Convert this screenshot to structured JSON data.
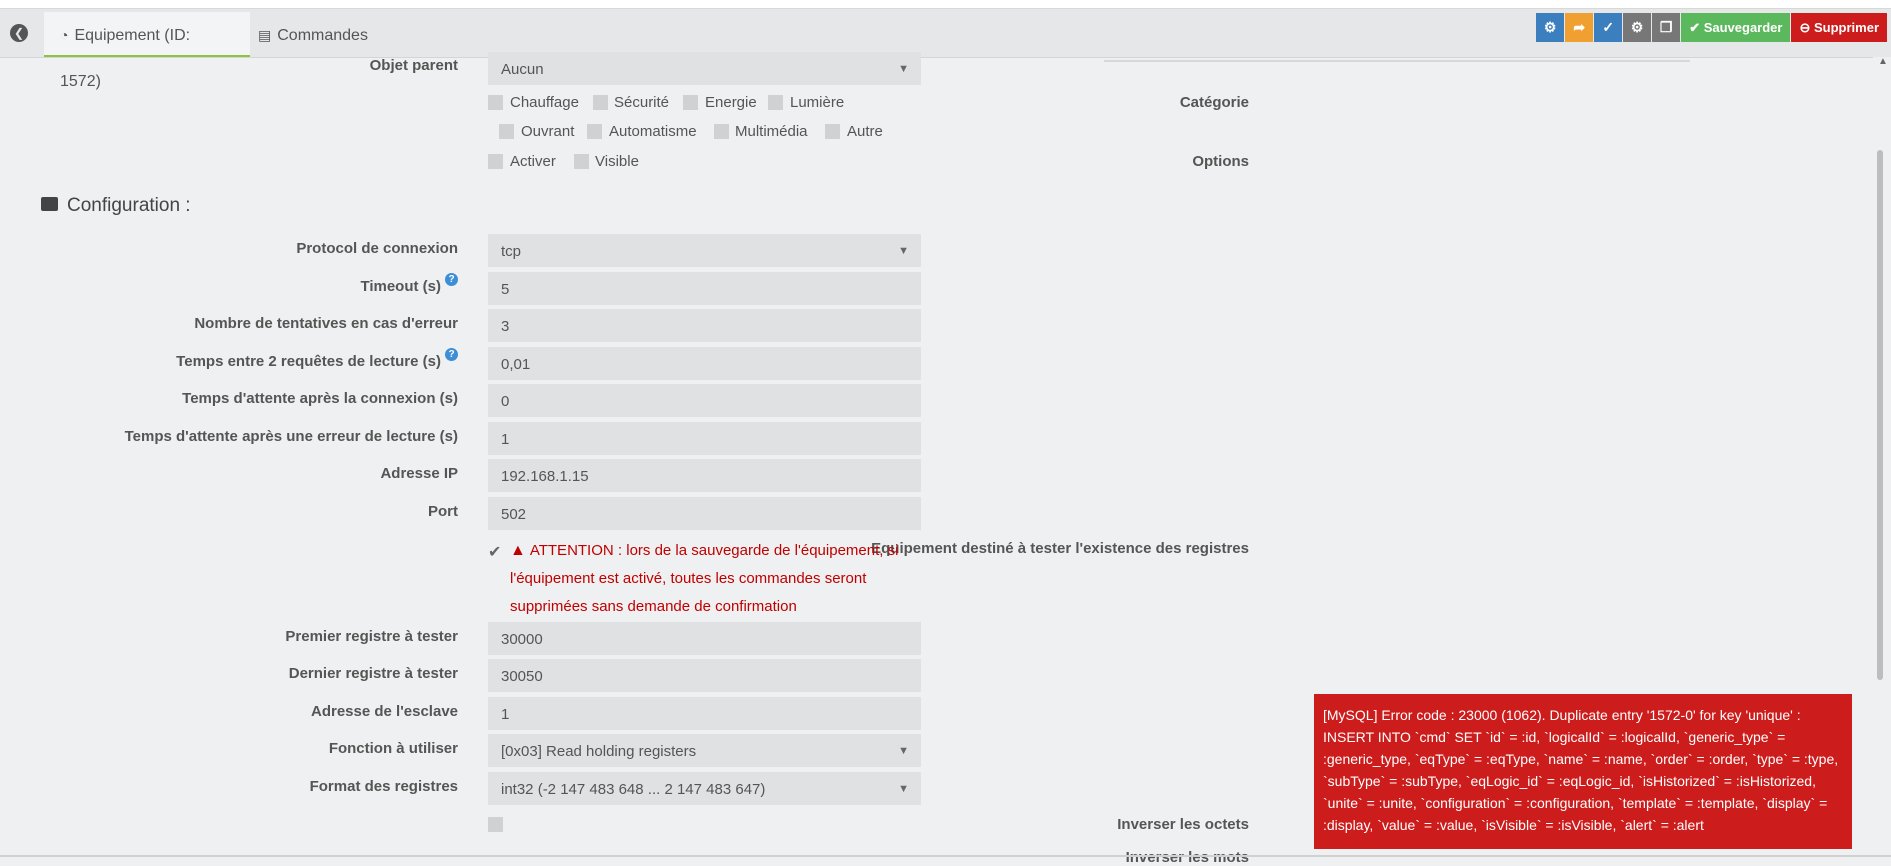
{
  "tabs": {
    "equipment_label": "Equipement (ID: 1572)",
    "commands_label": "Commandes"
  },
  "toolbar": {
    "save_label": "Sauvegarder",
    "delete_label": "Supprimer"
  },
  "general": {
    "parent_label": "Objet parent",
    "parent_value": "Aucun",
    "category_label": "Catégorie",
    "categories": [
      "Chauffage",
      "Sécurité",
      "Energie",
      "Lumière",
      "Ouvrant",
      "Automatisme",
      "Multimédia",
      "Autre"
    ],
    "options_label": "Options",
    "options": [
      "Activer",
      "Visible"
    ]
  },
  "config": {
    "section_title": "Configuration :",
    "fields": [
      {
        "label": "Protocol de connexion",
        "value": "tcp"
      },
      {
        "label": "Timeout (s)",
        "value": "5"
      },
      {
        "label": "Nombre de tentatives en cas d'erreur",
        "value": "3"
      },
      {
        "label": "Temps entre 2 requêtes de lecture (s)",
        "value": "0,01"
      },
      {
        "label": "Temps d'attente après la connexion (s)",
        "value": "0"
      },
      {
        "label": "Temps d'attente après une erreur de lecture (s)",
        "value": "1"
      },
      {
        "label": "Adresse IP",
        "value": "192.168.1.15"
      },
      {
        "label": "Port",
        "value": "502"
      }
    ],
    "test_label": "Equipement destiné à tester l'existence des registres",
    "warning_text": "ATTENTION : lors de la sauvegarde de l'équipement, si l'équipement est activé, toutes les commandes seront supprimées sans demande de confirmation",
    "fields2": [
      {
        "label": "Premier registre à tester",
        "value": "30000"
      },
      {
        "label": "Dernier registre à tester",
        "value": "30050"
      },
      {
        "label": "Adresse de l'esclave",
        "value": "1"
      },
      {
        "label": "Fonction à utiliser",
        "value": "[0x03] Read holding registers"
      },
      {
        "label": "Format des registres",
        "value": "int32 (-2 147 483 648 ... 2 147 483 647)"
      }
    ],
    "swap_bytes_label": "Inverser les octets",
    "swap_words_label": "Inverser les mots"
  },
  "error_toast": {
    "message": "[MySQL] Error code : 23000 (1062). Duplicate entry '1572-0' for key 'unique' : INSERT INTO `cmd` SET `id` = :id, `logicalId` = :logicalId, `generic_type` = :generic_type, `eqType` = :eqType, `name` = :name, `order` = :order, `type` = :type, `subType` = :subType, `eqLogic_id` = :eqLogic_id, `isHistorized` = :isHistorized, `unite` = :unite, `configuration` = :configuration, `template` = :template, `display` = :display, `value` = :value, `isVisible` = :isVisible, `alert` = :alert"
  },
  "colors": {
    "blue": "#3c7fbe",
    "orange": "#f0a030",
    "green": "#5cb85c",
    "red": "#cc1c1c",
    "active_tab_underline": "#8ec23f"
  }
}
